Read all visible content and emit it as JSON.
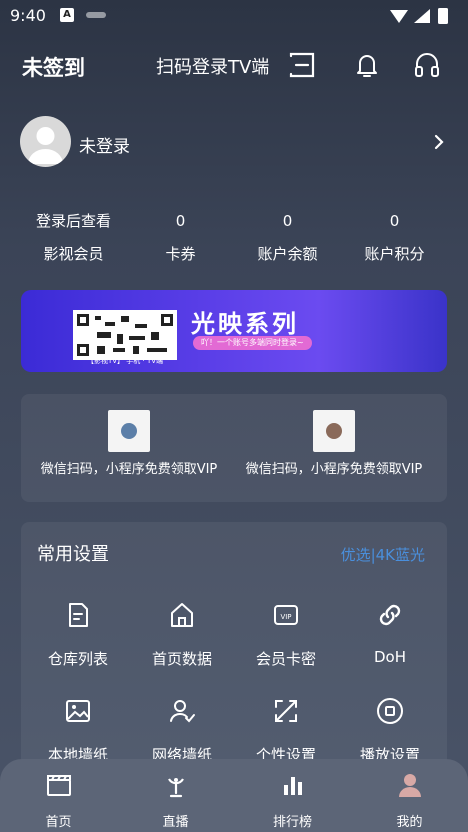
{
  "status_bar": {
    "time": "9:40",
    "a_badge": "A"
  },
  "header": {
    "title": "未签到",
    "tv_login": "扫码登录TV端"
  },
  "profile": {
    "name": "未登录"
  },
  "stats": [
    {
      "value": "登录后查看",
      "label": "影视会员"
    },
    {
      "value": "0",
      "label": "卡券"
    },
    {
      "value": "0",
      "label": "账户余额"
    },
    {
      "value": "0",
      "label": "账户积分"
    }
  ],
  "banner": {
    "title": "光映系列",
    "subtitle": "吖！一个账号多端同时登录~",
    "qr_caption": "【影视TV】 手机 · TV端"
  },
  "qr_promos": [
    {
      "caption": "微信扫码，小程序免费领取VIP"
    },
    {
      "caption": "微信扫码，小程序免费领取VIP"
    }
  ],
  "settings": {
    "title": "常用设置",
    "optional": "优选|4K蓝光",
    "items": [
      {
        "label": "仓库列表",
        "icon": "edit-file-icon"
      },
      {
        "label": "首页数据",
        "icon": "home-icon"
      },
      {
        "label": "会员卡密",
        "icon": "vip-card-icon"
      },
      {
        "label": "DoH",
        "icon": "link-icon"
      },
      {
        "label": "本地墙纸",
        "icon": "image-icon"
      },
      {
        "label": "网络墙纸",
        "icon": "user-check-icon"
      },
      {
        "label": "个性设置",
        "icon": "expand-icon"
      },
      {
        "label": "播放设置",
        "icon": "stop-circle-icon"
      }
    ]
  },
  "tabbar": [
    {
      "label": "首页",
      "icon": "clapperboard-icon"
    },
    {
      "label": "直播",
      "icon": "antenna-icon"
    },
    {
      "label": "排行榜",
      "icon": "bar-chart-icon"
    },
    {
      "label": "我的",
      "icon": "user-icon",
      "active": true
    }
  ],
  "colors": {
    "accent": "#4a8fdc",
    "banner": "#5b3fe8",
    "tabbar": "#5c6577"
  }
}
